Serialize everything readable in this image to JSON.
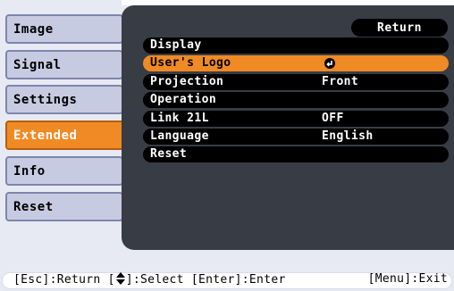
{
  "tabs": [
    {
      "label": "Image",
      "active": false
    },
    {
      "label": "Signal",
      "active": false
    },
    {
      "label": "Settings",
      "active": false
    },
    {
      "label": "Extended",
      "active": true
    },
    {
      "label": "Info",
      "active": false
    },
    {
      "label": "Reset",
      "active": false
    }
  ],
  "panel": {
    "return_label": "Return",
    "items": [
      {
        "label": "Display",
        "value": ""
      },
      {
        "label": "User's Logo",
        "value": "",
        "icon": "enter-icon"
      },
      {
        "label": "Projection",
        "value": "Front"
      },
      {
        "label": "Operation",
        "value": ""
      },
      {
        "label": "Link 21L",
        "value": "OFF"
      },
      {
        "label": "Language",
        "value": "English"
      },
      {
        "label": "Reset",
        "value": ""
      }
    ]
  },
  "footer": {
    "esc": "[Esc]:Return [",
    "select": "]:Select [Enter]:Enter",
    "exit": "[Menu]:Exit",
    "select_icon": "up-down-arrows-icon"
  },
  "colors": {
    "accent": "#f08a24",
    "panel_bg": "#383c44",
    "tab_bg": "#c7cbe1",
    "row_bg": "#000000"
  }
}
